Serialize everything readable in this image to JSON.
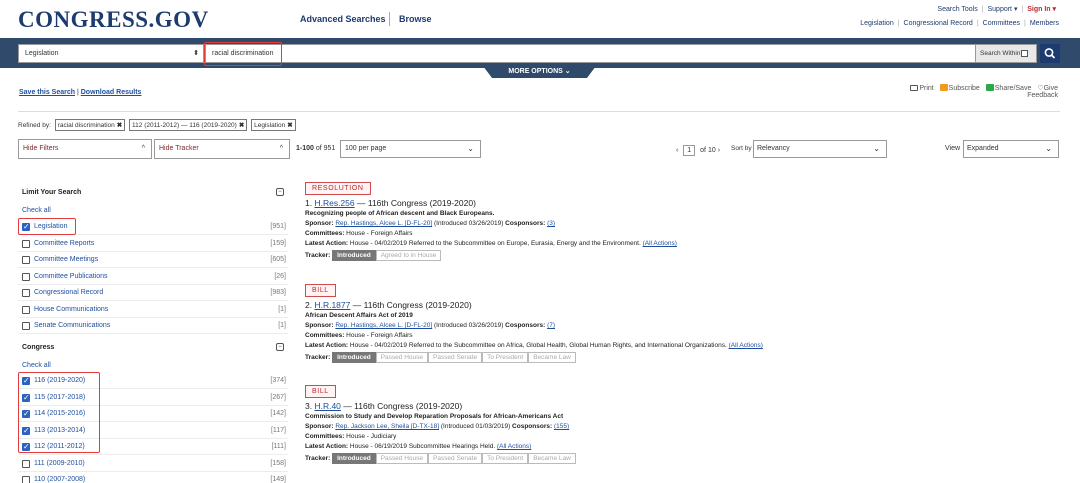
{
  "header": {
    "logo": "CONGRESS.GOV",
    "nav": [
      "Advanced Searches",
      "Browse"
    ],
    "tools": {
      "search_tools": "Search Tools",
      "support": "Support ▾",
      "sign_in": "Sign In ▾"
    },
    "links": [
      "Legislation",
      "Congressional Record",
      "Committees",
      "Members"
    ]
  },
  "search": {
    "collection": "Legislation",
    "query": "racial discrimination",
    "within_label": "Search Within",
    "more_options": "MORE OPTIONS ⌄"
  },
  "actions": {
    "save_search": "Save this Search",
    "download": "Download Results",
    "print": "Print",
    "subscribe": "Subscribe",
    "share": "Share/Save",
    "give": "Give",
    "feedback": "Feedback"
  },
  "refined": {
    "label": "Refined by:",
    "chips": [
      "racial discrimination",
      "112 (2011-2012) — 116 (2019-2020)",
      "Legislation"
    ]
  },
  "controls": {
    "hide_filters": "Hide Filters",
    "hide_tracker": "Hide Tracker",
    "range": "1-100",
    "of_total": " of 951",
    "per_page": "100 per page",
    "page": "1",
    "of_pages": "of 10",
    "sort_label": "Sort by",
    "sort_value": "Relevancy",
    "view_label": "View",
    "view_value": "Expanded"
  },
  "sidebar": {
    "limit_title": "Limit Your Search",
    "check_all": "Check all",
    "items": [
      {
        "label": "Legislation",
        "count": "[951]",
        "checked": true
      },
      {
        "label": "Committee Reports",
        "count": "[159]",
        "checked": false
      },
      {
        "label": "Committee Meetings",
        "count": "[605]",
        "checked": false
      },
      {
        "label": "Committee Publications",
        "count": "[26]",
        "checked": false
      },
      {
        "label": "Congressional Record",
        "count": "[983]",
        "checked": false
      },
      {
        "label": "House Communications",
        "count": "[1]",
        "checked": false
      },
      {
        "label": "Senate Communications",
        "count": "[1]",
        "checked": false
      }
    ],
    "congress_title": "Congress",
    "congress_check_all": "Check all",
    "congress": [
      {
        "label": "116 (2019-2020)",
        "count": "[374]",
        "checked": true
      },
      {
        "label": "115 (2017-2018)",
        "count": "[267]",
        "checked": true
      },
      {
        "label": "114 (2015-2016)",
        "count": "[142]",
        "checked": true
      },
      {
        "label": "113 (2013-2014)",
        "count": "[117]",
        "checked": true
      },
      {
        "label": "112 (2011-2012)",
        "count": "[111]",
        "checked": true
      },
      {
        "label": "111 (2009-2010)",
        "count": "[158]",
        "checked": false
      },
      {
        "label": "110 (2007-2008)",
        "count": "[149]",
        "checked": false
      }
    ]
  },
  "results": [
    {
      "type": "RESOLUTION",
      "num": "1.",
      "id": "H.Res.256",
      "congress": " — 116th Congress (2019-2020)",
      "title": "Recognizing people of African descent and Black Europeans.",
      "sponsor_label": "Sponsor:",
      "sponsor": "Rep. Hastings, Alcee L. [D-FL-20]",
      "introduced": " (Introduced 03/26/2019) ",
      "cosponsors_label": "Cosponsors:",
      "cosponsors": "(3)",
      "committees_label": "Committees:",
      "committees": " House - Foreign Affairs",
      "latest_label": "Latest Action:",
      "latest": " House - 04/02/2019 Referred to the Subcommittee on Europe, Eurasia, Energy and the Environment. ",
      "all_actions": "(All Actions)",
      "tracker_label": "Tracker:",
      "tracker": [
        {
          "step": "Introduced",
          "on": true
        },
        {
          "step": "Agreed to in House",
          "on": false
        }
      ]
    },
    {
      "type": "BILL",
      "num": "2.",
      "id": "H.R.1877",
      "congress": " — 116th Congress (2019-2020)",
      "title": "African Descent Affairs Act of 2019",
      "sponsor_label": "Sponsor:",
      "sponsor": "Rep. Hastings, Alcee L. [D-FL-20]",
      "introduced": " (Introduced 03/26/2019) ",
      "cosponsors_label": "Cosponsors:",
      "cosponsors": "(7)",
      "committees_label": "Committees:",
      "committees": " House - Foreign Affairs",
      "latest_label": "Latest Action:",
      "latest": " House - 04/02/2019 Referred to the Subcommittee on Africa, Global Health, Global Human Rights, and International Organizations. ",
      "all_actions": "(All Actions)",
      "tracker_label": "Tracker:",
      "tracker": [
        {
          "step": "Introduced",
          "on": true
        },
        {
          "step": "Passed House",
          "on": false
        },
        {
          "step": "Passed Senate",
          "on": false
        },
        {
          "step": "To President",
          "on": false
        },
        {
          "step": "Became Law",
          "on": false
        }
      ]
    },
    {
      "type": "BILL",
      "num": "3.",
      "id": "H.R.40",
      "congress": " — 116th Congress (2019-2020)",
      "title": "Commission to Study and Develop Reparation Proposals for African-Americans Act",
      "sponsor_label": "Sponsor:",
      "sponsor": "Rep. Jackson Lee, Sheila [D-TX-18]",
      "introduced": " (Introduced 01/03/2019) ",
      "cosponsors_label": "Cosponsors:",
      "cosponsors": "(155)",
      "committees_label": "Committees:",
      "committees": " House - Judiciary",
      "latest_label": "Latest Action:",
      "latest": " House - 06/19/2019 Subcommittee Hearings Held. ",
      "all_actions": "(All Actions)",
      "tracker_label": "Tracker:",
      "tracker": [
        {
          "step": "Introduced",
          "on": true
        },
        {
          "step": "Passed House",
          "on": false
        },
        {
          "step": "Passed Senate",
          "on": false
        },
        {
          "step": "To President",
          "on": false
        },
        {
          "step": "Became Law",
          "on": false
        }
      ]
    }
  ]
}
